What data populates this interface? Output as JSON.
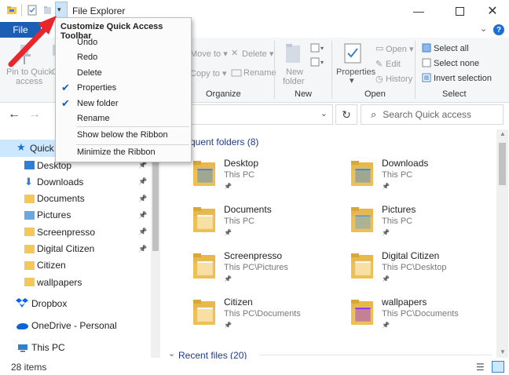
{
  "window": {
    "title": "File Explorer"
  },
  "ribbon": {
    "file_tab": "File",
    "pin_label_1": "Pin to Quick",
    "pin_label_2": "access",
    "copy_partial": "C",
    "move_to": "Move to",
    "copy_to": "Copy to",
    "delete": "Delete",
    "rename": "Rename",
    "new_folder_1": "New",
    "new_folder_2": "folder",
    "properties": "Properties",
    "open": "Open",
    "edit": "Edit",
    "history": "History",
    "select_all": "Select all",
    "select_none": "Select none",
    "invert_selection": "Invert selection",
    "groups": {
      "organize": "Organize",
      "new": "New",
      "open": "Open",
      "select": "Select"
    }
  },
  "navbar": {
    "search_placeholder": "Search Quick access"
  },
  "menu": {
    "title": "Customize Quick Access Toolbar",
    "items": [
      {
        "label": "Undo",
        "checked": false
      },
      {
        "label": "Redo",
        "checked": false
      },
      {
        "label": "Delete",
        "checked": false
      },
      {
        "label": "Properties",
        "checked": true
      },
      {
        "label": "New folder",
        "checked": true
      },
      {
        "label": "Rename",
        "checked": false
      }
    ],
    "show_below": "Show below the Ribbon",
    "minimize": "Minimize the Ribbon"
  },
  "nav": {
    "quick_access": "Quick a",
    "items": [
      {
        "label": "Desktop",
        "pinned": true
      },
      {
        "label": "Downloads",
        "pinned": true
      },
      {
        "label": "Documents",
        "pinned": true
      },
      {
        "label": "Pictures",
        "pinned": true
      },
      {
        "label": "Screenpresso",
        "pinned": true
      },
      {
        "label": "Digital Citizen",
        "pinned": true
      },
      {
        "label": "Citizen",
        "pinned": false
      },
      {
        "label": "wallpapers",
        "pinned": false
      }
    ],
    "dropbox": "Dropbox",
    "onedrive": "OneDrive - Personal",
    "this_pc": "This PC"
  },
  "content": {
    "frequent_header": "quent folders (8)",
    "recent_header": "Recent files (20)",
    "folders": [
      {
        "name": "Desktop",
        "path": "This PC"
      },
      {
        "name": "Downloads",
        "path": "This PC"
      },
      {
        "name": "Documents",
        "path": "This PC"
      },
      {
        "name": "Pictures",
        "path": "This PC"
      },
      {
        "name": "Screenpresso",
        "path": "This PC\\Pictures"
      },
      {
        "name": "Digital Citizen",
        "path": "This PC\\Desktop"
      },
      {
        "name": "Citizen",
        "path": "This PC\\Documents"
      },
      {
        "name": "wallpapers",
        "path": "This PC\\Documents"
      }
    ]
  },
  "status": {
    "count": "28 items"
  },
  "colors": {
    "accent": "#1a5fb4",
    "folder": "#f3c75a",
    "arrow": "#e8272d"
  }
}
